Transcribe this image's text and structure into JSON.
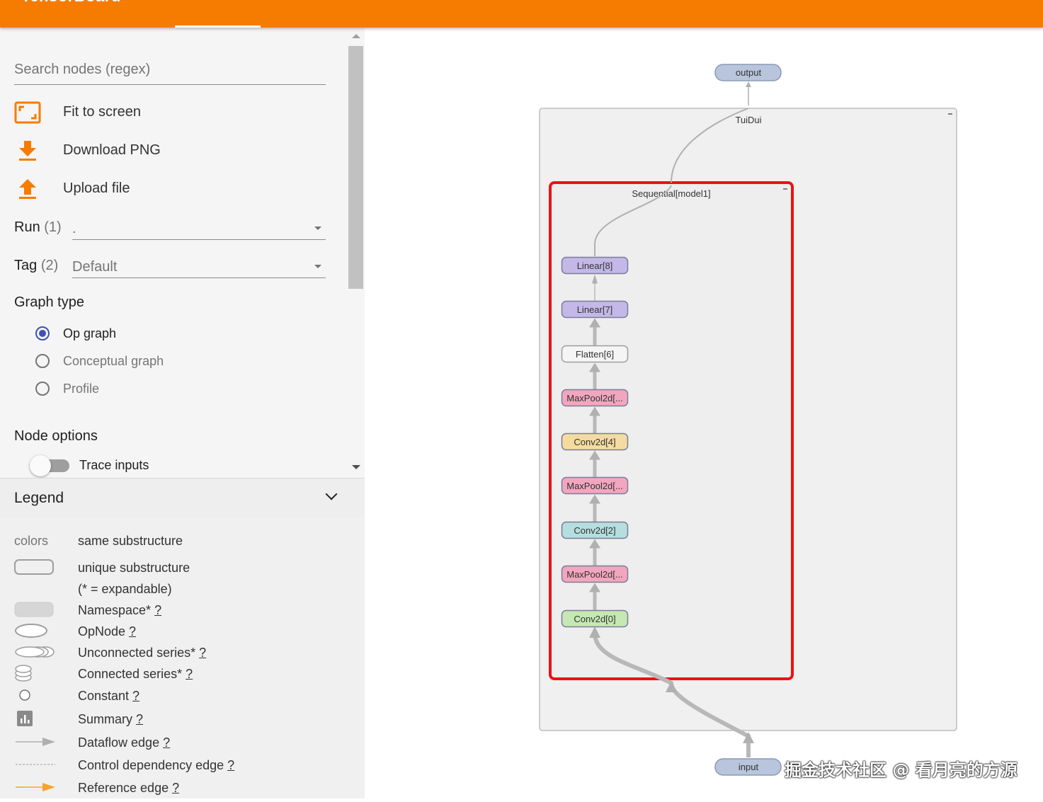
{
  "app": {
    "logo": "TensorBoard"
  },
  "sidebar": {
    "search_placeholder": "Search nodes (regex)",
    "actions": {
      "fit": "Fit to screen",
      "download": "Download PNG",
      "upload": "Upload file"
    },
    "run": {
      "label": "Run",
      "count": "(1)",
      "value": "."
    },
    "tag": {
      "label": "Tag",
      "count": "(2)",
      "value": "Default"
    },
    "graph_type": {
      "title": "Graph type",
      "options": [
        {
          "label": "Op graph",
          "selected": true
        },
        {
          "label": "Conceptual graph",
          "selected": false
        },
        {
          "label": "Profile",
          "selected": false
        }
      ]
    },
    "node_options": {
      "title": "Node options",
      "trace_inputs": "Trace inputs",
      "trace_inputs_on": false
    },
    "legend": {
      "title": "Legend",
      "colors_key": "colors",
      "colors_value": "same substructure",
      "items": [
        {
          "text": "unique substructure",
          "q": ""
        },
        {
          "text": "(* = expandable)",
          "q": ""
        },
        {
          "text": "Namespace*",
          "q": "?"
        },
        {
          "text": "OpNode",
          "q": "?"
        },
        {
          "text": "Unconnected series*",
          "q": "?"
        },
        {
          "text": "Connected series*",
          "q": "?"
        },
        {
          "text": "Constant",
          "q": "?"
        },
        {
          "text": "Summary",
          "q": "?"
        },
        {
          "text": "Dataflow edge",
          "q": "?"
        },
        {
          "text": "Control dependency edge",
          "q": "?"
        },
        {
          "text": "Reference edge",
          "q": "?"
        }
      ]
    }
  },
  "graph": {
    "output_node": "output",
    "input_node": "input",
    "outer_group": "TuiDui",
    "inner_group": "Sequential[model1]",
    "nodes": [
      {
        "label": "Linear[8]",
        "color": "#c3b8e8"
      },
      {
        "label": "Linear[7]",
        "color": "#c3b8e8"
      },
      {
        "label": "Flatten[6]",
        "color": "#f5f5f5"
      },
      {
        "label": "MaxPool2d[...",
        "color": "#f2a6bd"
      },
      {
        "label": "Conv2d[4]",
        "color": "#f4dca0"
      },
      {
        "label": "MaxPool2d[...",
        "color": "#f2a6bd"
      },
      {
        "label": "Conv2d[2]",
        "color": "#b5dede"
      },
      {
        "label": "MaxPool2d[...",
        "color": "#f2a6bd"
      },
      {
        "label": "Conv2d[0]",
        "color": "#c6e8b4"
      }
    ],
    "highlight_color": "#ee1111"
  },
  "watermark": "掘金技术社区 @ 看月亮的方源"
}
